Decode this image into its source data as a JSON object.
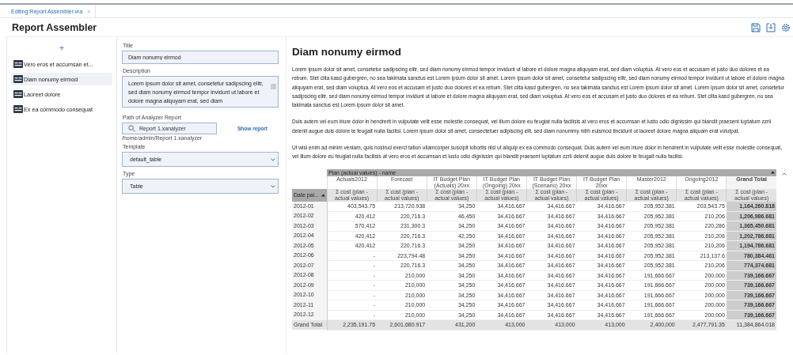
{
  "tab": {
    "label": "Editing:Report Assembler.vra",
    "close": "×"
  },
  "header": {
    "title": "Report Assembler"
  },
  "sidebar": {
    "add": "+",
    "items": [
      {
        "label": "Vero eros et accumsan et...",
        "selected": false
      },
      {
        "label": "Diam nonumy eirmod",
        "selected": true
      },
      {
        "label": "Laoreet dolore",
        "selected": false
      },
      {
        "label": "Ex ea commodo consequat",
        "selected": false
      }
    ]
  },
  "form": {
    "title_label": "Title",
    "title_value": "Diam nonumy eirmod",
    "description_label": "Description",
    "description_value": "Lorem ipsum dolor sit amet, consetetur sadipscing elitr, sed diam nonumy eirmod tempor invidunt ut labore et dolore magna aliquyam erat, sed diam",
    "path_label": "Path of Analyzer Report",
    "path_value": "Report 1.xanalyzer",
    "path_hint": "/home/admin/Report 1.xanalyzer",
    "show_report": "Show report",
    "template_label": "Template",
    "template_value": "default_table",
    "type_label": "Type",
    "type_value": "Table"
  },
  "report": {
    "title": "Diam nonumy eirmod",
    "paragraphs": [
      "Lorem ipsum dolor sit amet, consetetur sadipscing elitr, sed diam nonumy eirmod tempor invidunt ut labore et dolore magna aliquyam erat, sed diam voluptua. At vero eos et accusam et justo duo dolores et ea rebum. Stet clita kasd gubergren, no sea takimata sanctus est Lorem ipsum dolor sit amet. Lorem ipsum dolor sit amet, consetetur sadipscing elitr, sed diam nonumy eirmod tempor invidunt ut labore et dolore magna aliquyam erat, sed diam voluptua. At vero eos et accusam et justo duo dolores et ea rebum. Stet clita kasd gubergren, no sea takimata sanctus est Lorem ipsum dolor sit amet. Lorem ipsum dolor sit amet, consetetur sadipscing elitr, sed diam nonumy eirmod tempor invidunt ut labore et dolore magna aliquyam erat, sed diam voluptua. At vero eos et accusam et justo duo dolores et ea rebum. Stet clita kasd gubergren, no sea takimata sanctus est Lorem ipsum dolor sit amet.",
      "Duis autem vel eum iriure dolor in hendrerit in vulputate velit esse molestie consequat, vel illum dolore eu feugiat nulla facilisis at vero eros et accumsan et iusto odio dignissim qui blandit praesent luptatum zzril delenit augue duis dolore te feugait nulla facilisi. Lorem ipsum dolor sit amet, consectetuer adipiscing elit, sed diam nonummy nibh euismod tincidunt ut laoreet dolore magna aliquam erat volutpat.",
      "Ut wisi enim ad minim veniam, quis nostrud exerci tation ullamcorper suscipit lobortis nisl ut aliquip ex ea commodo consequat. Duis autem vel eum iriure dolor in hendrerit in vulputate velit esse molestie consequat, vel illum dolore eu feugiat nulla facilisis at vero eros et accumsan et iusto odio dignissim qui blandit praesent luptatum zzril delenit augue duis dolore te feugait nulla facilisi."
    ]
  },
  "pivot": {
    "group_header": "Plan (actual values) - name",
    "row_header": "Date pai...",
    "columns": [
      {
        "label": "Actuals2012",
        "measure": "Σ cost (plan - actual values)",
        "kind": "plain"
      },
      {
        "label": "Forecast",
        "measure": "Σ cost (plan - actual values)",
        "kind": "plain"
      },
      {
        "label": "IT Budget Plan (Actuals) 20xx",
        "measure": "Σ cost (plan - actual values)",
        "kind": "plain"
      },
      {
        "label": "IT Budget Plan (Ongoing) 20xx",
        "measure": "Σ cost (plan - actual values)",
        "kind": "plain"
      },
      {
        "label": "IT Budget Plan (Scenario) 20xx",
        "measure": "Σ cost (plan - actual values)",
        "kind": "plain"
      },
      {
        "label": "IT Budget Plan 20xx",
        "measure": "Σ cost (plan - actual values)",
        "kind": "plain"
      },
      {
        "label": "Master2012",
        "measure": "Σ cost (plan - actual values)",
        "kind": "plain"
      },
      {
        "label": "Ongoing2012",
        "measure": "Σ cost (plan - actual values)",
        "kind": "plain"
      },
      {
        "label": "Grand Total",
        "measure": "Σ cost (plan - actual values)",
        "kind": "total"
      }
    ],
    "rows": [
      {
        "label": "2012-01",
        "cells": [
          "403,543.75",
          "213,720.938",
          "34,250",
          "34,416.667",
          "34,416.667",
          "34,416.667",
          "205,952.381",
          "203,543.75",
          "1,164,260.818"
        ]
      },
      {
        "label": "2012-02",
        "cells": [
          "420,412",
          "220,716.3",
          "46,450",
          "34,416.667",
          "34,416.667",
          "34,416.667",
          "205,952.381",
          "210,206",
          "1,206,986.681"
        ]
      },
      {
        "label": "2012-03",
        "cells": [
          "570,412",
          "231,300.3",
          "34,250",
          "34,416.667",
          "34,416.667",
          "34,416.667",
          "205,952.381",
          "220,286",
          "1,365,450.681"
        ]
      },
      {
        "label": "2012-04",
        "cells": [
          "420,412",
          "220,716.3",
          "42,250",
          "34,416.667",
          "34,416.667",
          "34,416.667",
          "205,952.381",
          "210,206",
          "1,202,786.681"
        ]
      },
      {
        "label": "2012-05",
        "cells": [
          "420,412",
          "220,716.3",
          "34,250",
          "34,416.667",
          "34,416.667",
          "34,416.667",
          "205,952.381",
          "210,206",
          "1,194,786.681"
        ]
      },
      {
        "label": "2012-06",
        "cells": [
          "-",
          "223,794.48",
          "34,250",
          "34,416.667",
          "34,416.667",
          "34,416.667",
          "205,952.381",
          "213,137.6",
          "780,384.461"
        ]
      },
      {
        "label": "2012-07",
        "cells": [
          "-",
          "220,716.3",
          "34,250",
          "34,416.667",
          "34,416.667",
          "34,416.667",
          "205,952.381",
          "210,206",
          "774,374.681"
        ]
      },
      {
        "label": "2012-08",
        "cells": [
          "-",
          "210,000",
          "34,250",
          "34,416.667",
          "34,416.667",
          "34,416.667",
          "191,666.667",
          "200,000",
          "739,166.667"
        ]
      },
      {
        "label": "2012-09",
        "cells": [
          "-",
          "210,000",
          "34,250",
          "34,416.667",
          "34,416.667",
          "34,416.667",
          "191,666.667",
          "200,000",
          "739,166.667"
        ]
      },
      {
        "label": "2012-10",
        "cells": [
          "-",
          "210,000",
          "34,250",
          "34,416.667",
          "34,416.667",
          "34,416.667",
          "191,666.667",
          "200,000",
          "739,166.667"
        ]
      },
      {
        "label": "2012-11",
        "cells": [
          "-",
          "210,000",
          "34,250",
          "34,416.667",
          "34,416.667",
          "34,416.667",
          "191,666.667",
          "200,000",
          "739,166.667"
        ]
      },
      {
        "label": "2012-12",
        "cells": [
          "-",
          "210,000",
          "34,250",
          "34,416.667",
          "34,416.667",
          "34,416.667",
          "191,666.667",
          "200,000",
          "739,166.667"
        ]
      }
    ],
    "total": {
      "label": "Grand Total",
      "cells": [
        "2,235,191.75",
        "2,601,680.917",
        "431,200",
        "413,000",
        "413,000",
        "413,000",
        "2,400,000",
        "2,477,791.35",
        "11,384,864.018"
      ]
    }
  }
}
